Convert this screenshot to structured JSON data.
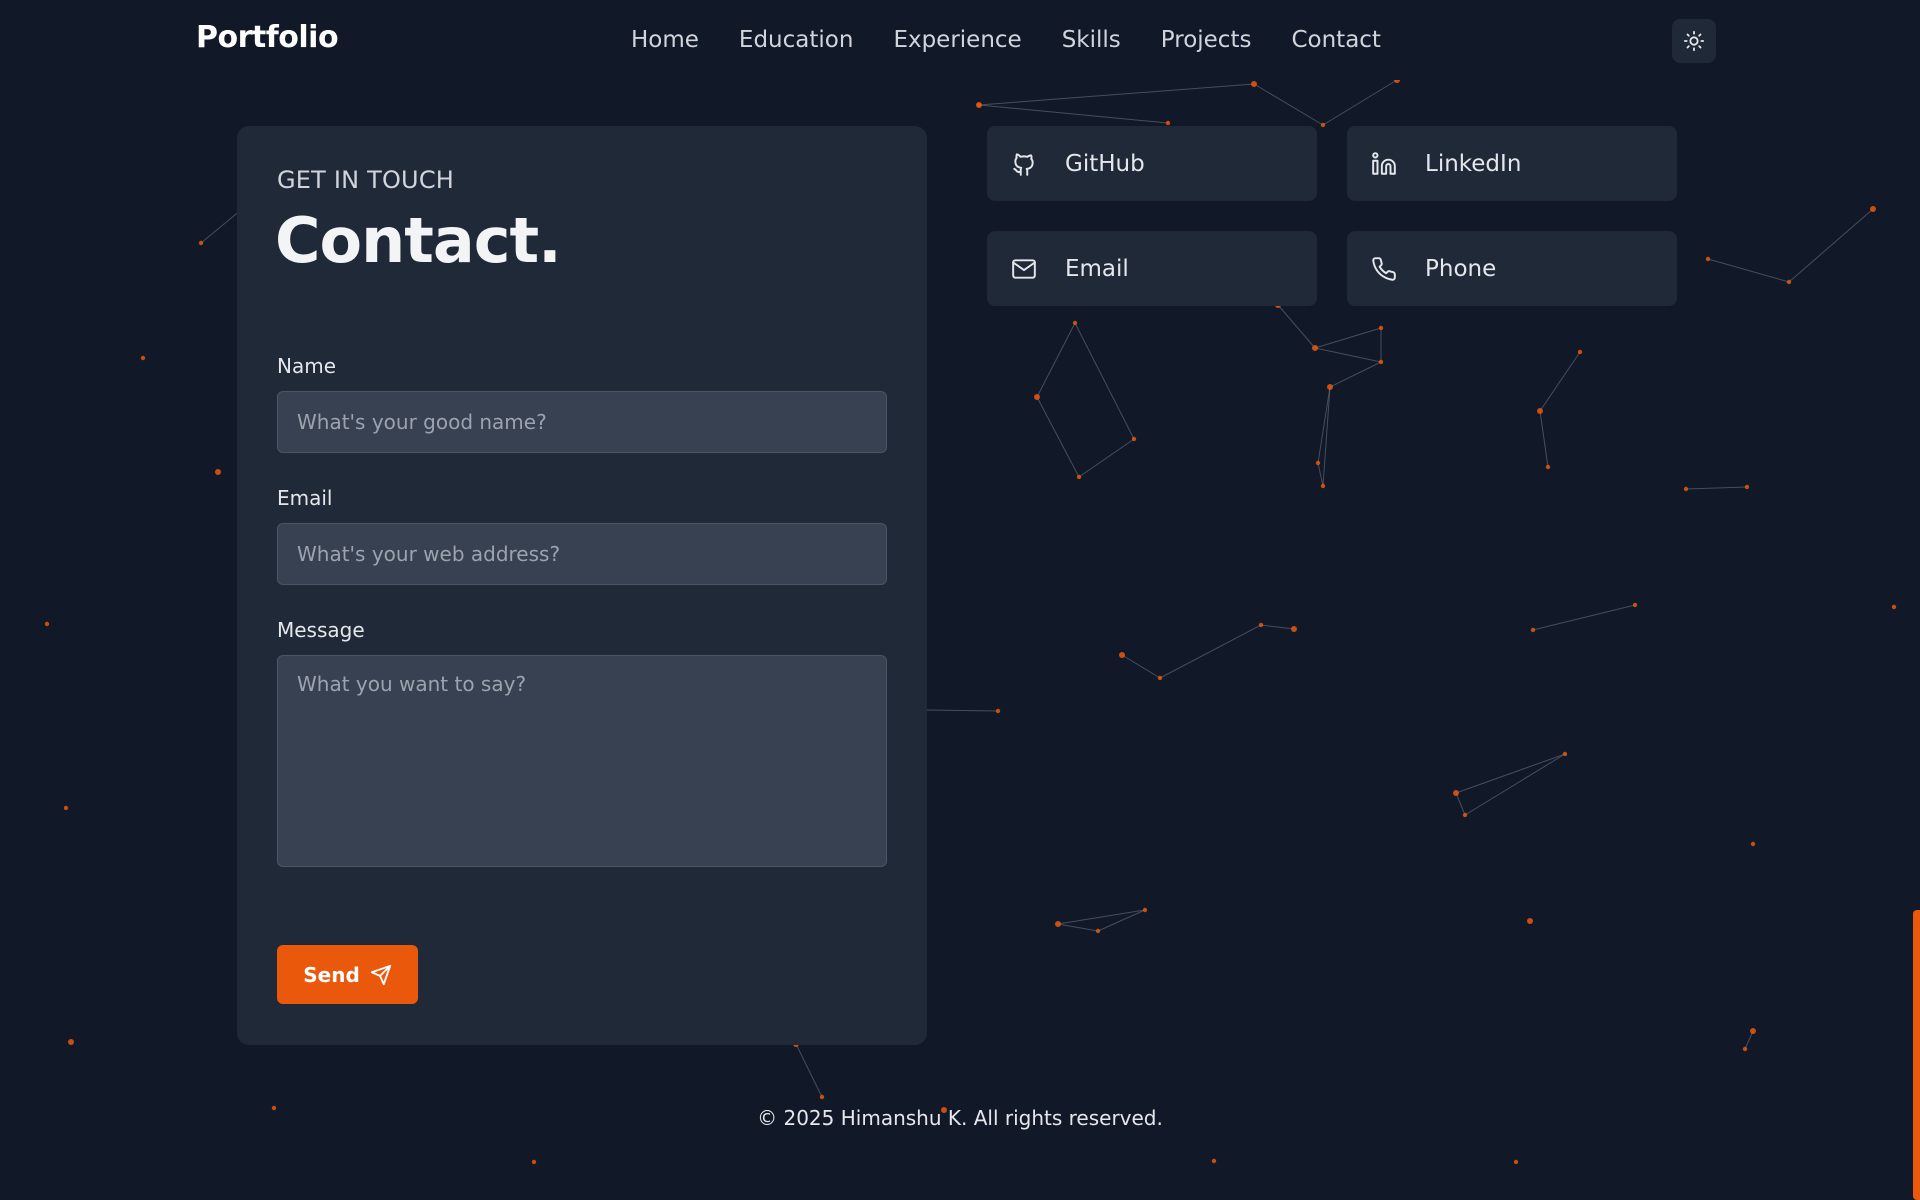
{
  "header": {
    "brand": "Portfolio",
    "nav": [
      "Home",
      "Education",
      "Experience",
      "Skills",
      "Projects",
      "Contact"
    ],
    "theme_icon": "sun-icon"
  },
  "contact": {
    "eyebrow": "GET IN TOUCH",
    "title": "Contact.",
    "name_label": "Name",
    "name_placeholder": "What's your good name?",
    "email_label": "Email",
    "email_placeholder": "What's your web address?",
    "message_label": "Message",
    "message_placeholder": "What you want to say?",
    "send_label": "Send",
    "send_icon": "send-icon"
  },
  "socials": [
    {
      "label": "GitHub",
      "icon": "github-icon"
    },
    {
      "label": "LinkedIn",
      "icon": "linkedin-icon"
    },
    {
      "label": "Email",
      "icon": "mail-icon"
    },
    {
      "label": "Phone",
      "icon": "phone-icon"
    }
  ],
  "footer": {
    "copyright": "© 2025 Himanshu K. All rights reserved."
  },
  "colors": {
    "background": "#111827",
    "surface": "#1f2937",
    "input": "#374151",
    "accent": "#ea580c"
  }
}
